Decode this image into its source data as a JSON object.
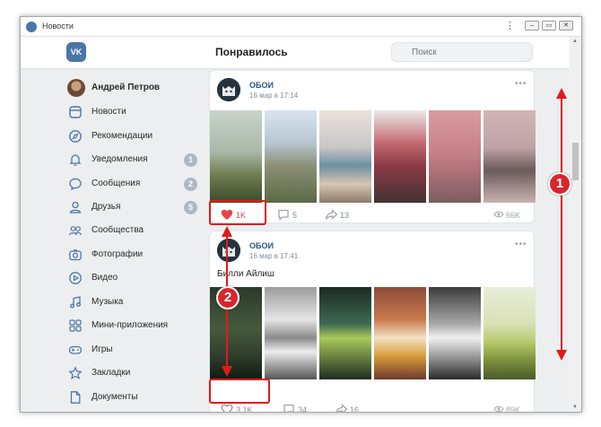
{
  "window": {
    "title": "Новости"
  },
  "header": {
    "page_title": "Понравилось",
    "logo": "VK",
    "search_placeholder": "Поиск"
  },
  "sidebar": {
    "profile_name": "Андрей Петров",
    "items": [
      {
        "label": "Новости",
        "icon": "news-icon",
        "badge": ""
      },
      {
        "label": "Рекомендации",
        "icon": "compass-icon",
        "badge": ""
      },
      {
        "label": "Уведомления",
        "icon": "bell-icon",
        "badge": "1"
      },
      {
        "label": "Сообщения",
        "icon": "message-icon",
        "badge": "2"
      },
      {
        "label": "Друзья",
        "icon": "user-icon",
        "badge": "5"
      },
      {
        "label": "Сообщества",
        "icon": "group-icon",
        "badge": ""
      },
      {
        "label": "Фотографии",
        "icon": "camera-icon",
        "badge": ""
      },
      {
        "label": "Видео",
        "icon": "play-icon",
        "badge": ""
      },
      {
        "label": "Музыка",
        "icon": "music-icon",
        "badge": ""
      },
      {
        "label": "Мини-приложения",
        "icon": "apps-icon",
        "badge": ""
      },
      {
        "label": "Игры",
        "icon": "gamepad-icon",
        "badge": ""
      },
      {
        "label": "Закладки",
        "icon": "star-icon",
        "badge": ""
      },
      {
        "label": "Документы",
        "icon": "document-icon",
        "badge": ""
      }
    ]
  },
  "posts": [
    {
      "author": "ОБОИ",
      "time": "16 мар в 17:14",
      "text": "",
      "likes": "1K",
      "comments": "5",
      "shares": "13",
      "views": "66K",
      "liked": true
    },
    {
      "author": "ОБОИ",
      "time": "16 мар в 17:41",
      "text": "Билли Айлиш",
      "likes": "3,1K",
      "comments": "34",
      "shares": "16",
      "views": "89K",
      "liked": false
    }
  ],
  "annotations": {
    "marker_1": "1",
    "marker_2": "2"
  },
  "colors": {
    "accent": "#4a76a8",
    "like_red": "#e64646",
    "highlight": "#e01b1b",
    "marker": "#d7272d",
    "background": "#edeef0"
  }
}
